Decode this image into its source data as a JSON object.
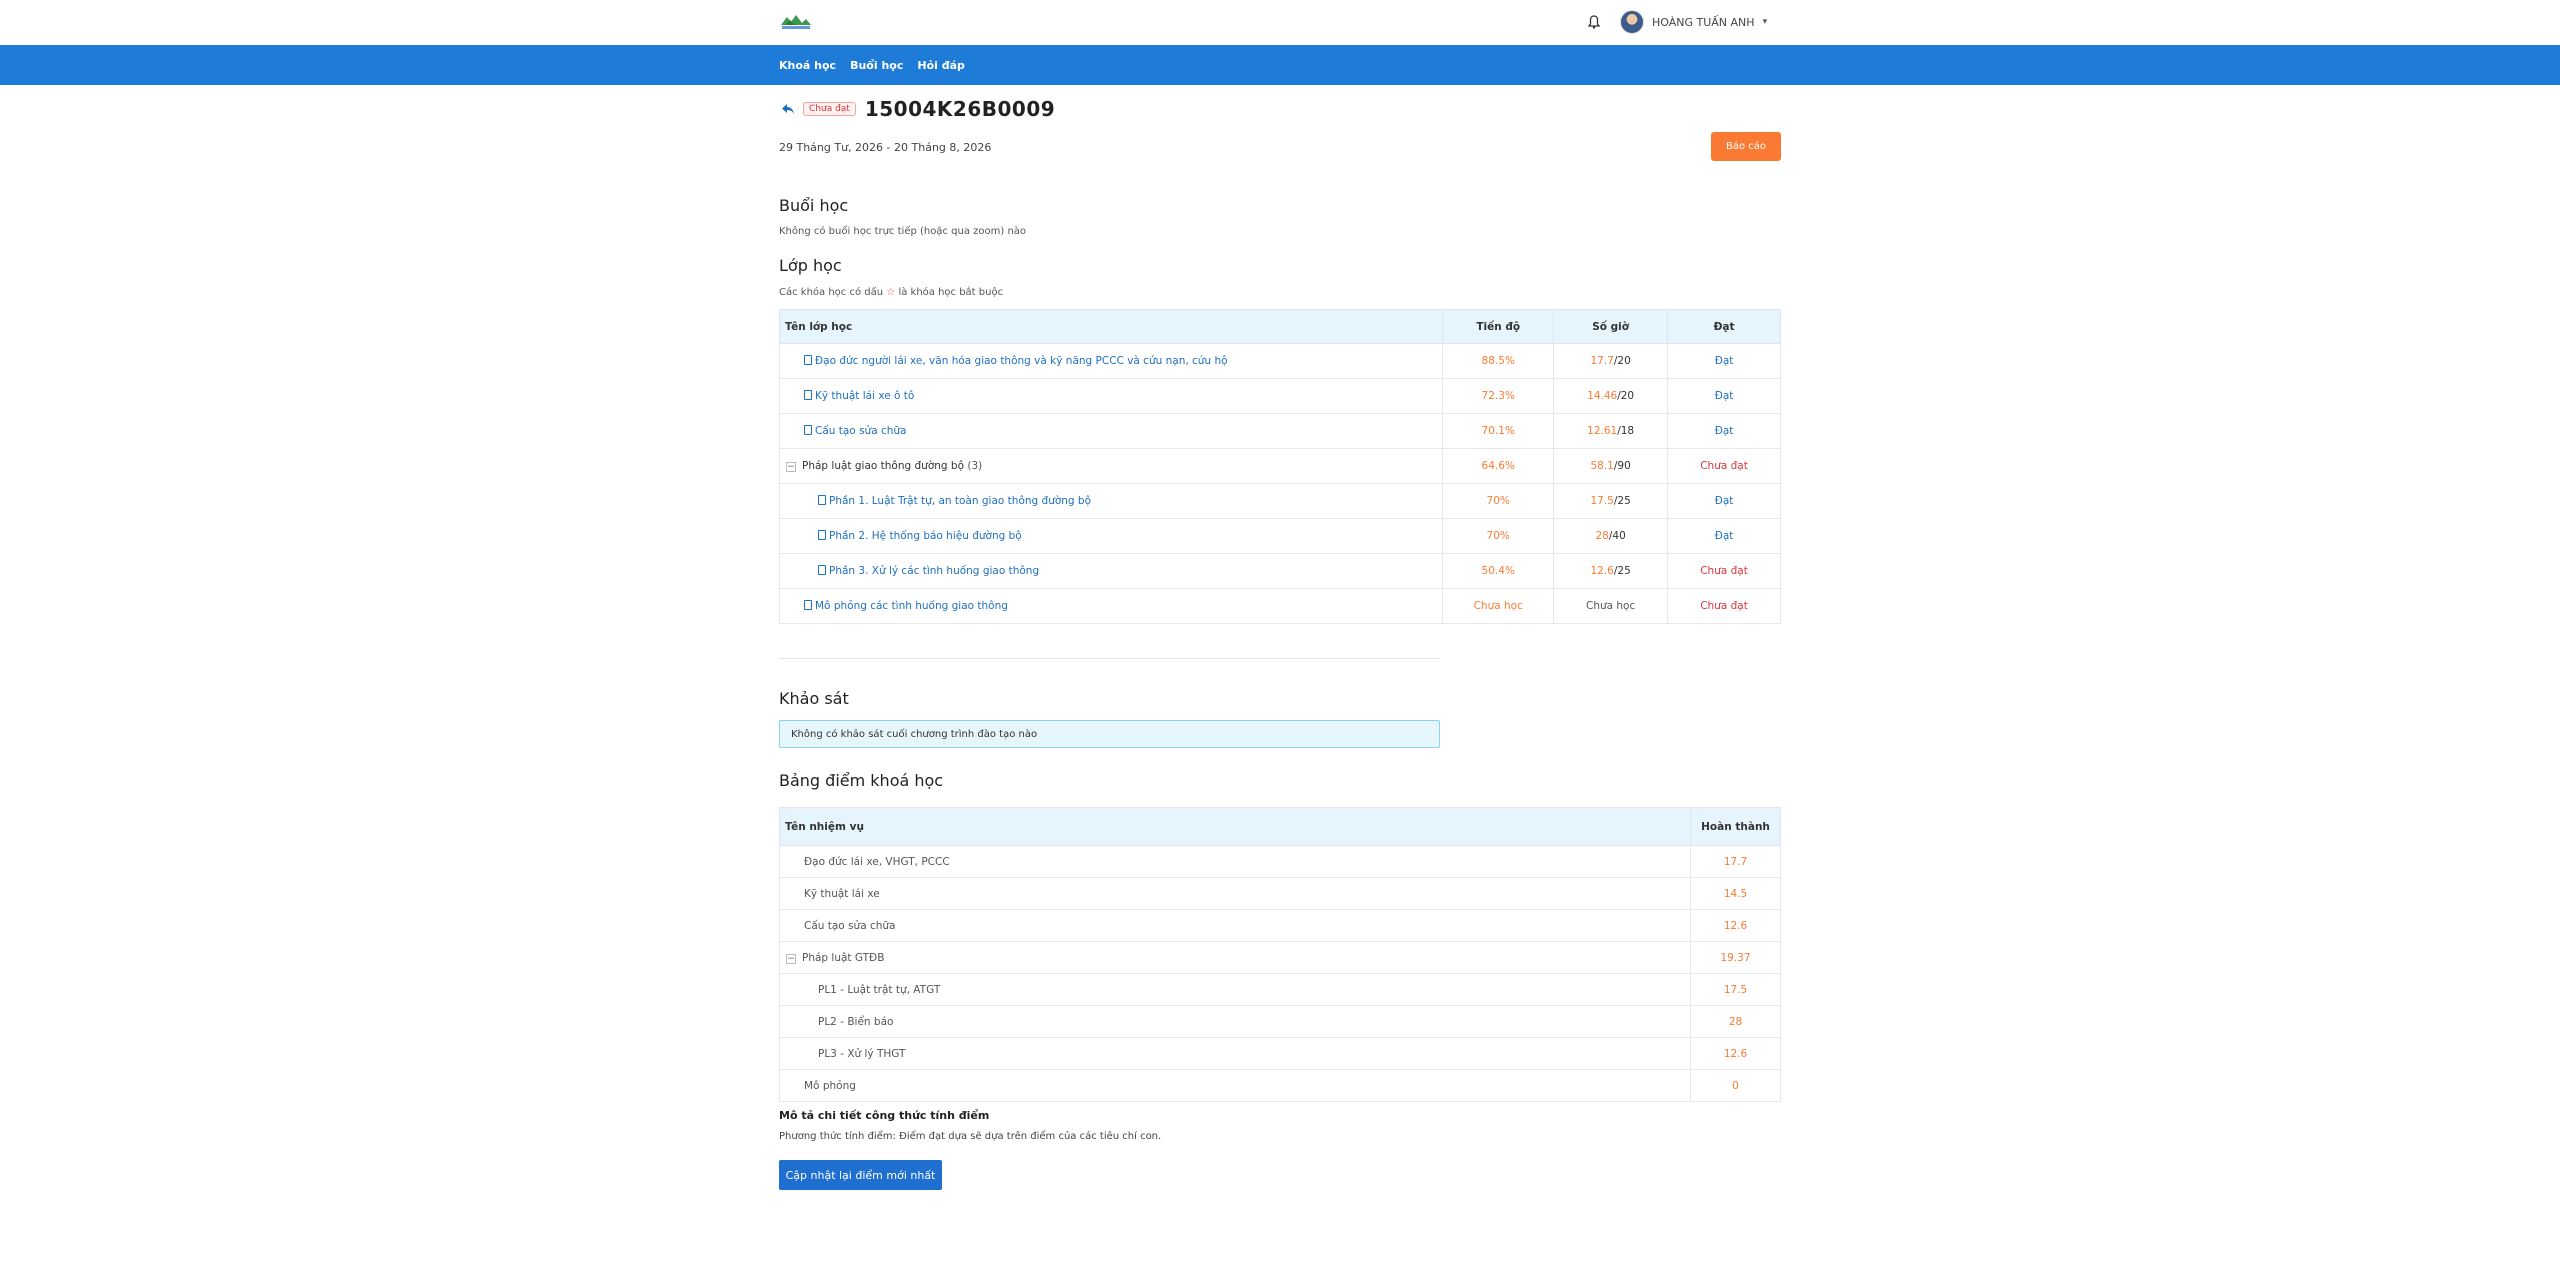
{
  "header": {
    "user_name": "HOÀNG TUẤN ANH"
  },
  "nav": {
    "items": [
      "Khoá học",
      "Buổi học",
      "Hỏi đáp"
    ]
  },
  "course": {
    "status_badge": "Chưa đạt",
    "code": "15004K26B0009",
    "date_range": "29 Tháng Tư, 2026 - 20 Tháng 8, 2026",
    "report_button": "Báo cáo"
  },
  "sessions": {
    "title": "Buổi học",
    "empty_text": "Không có buổi học trực tiếp (hoặc qua zoom) nào"
  },
  "classes": {
    "title": "Lớp học",
    "note_prefix": "Các khóa học có dấu",
    "note_star": "☆",
    "note_suffix": "là khóa học bắt buộc",
    "columns": {
      "name": "Tên lớp học",
      "progress": "Tiến độ",
      "hours": "Số giờ",
      "pass": "Đạt"
    },
    "rows": [
      {
        "name": "Đạo đức người lái xe, văn hóa giao thông và kỹ năng PCCC và cứu nạn, cứu hộ",
        "progress": "88.5%",
        "hours_done": "17.7",
        "hours_total": "/20",
        "pass": "Đạt"
      },
      {
        "name": "Kỹ thuật lái xe ô tô",
        "progress": "72.3%",
        "hours_done": "14.46",
        "hours_total": "/20",
        "pass": "Đạt"
      },
      {
        "name": "Cấu tạo sửa chữa",
        "progress": "70.1%",
        "hours_done": "12.61",
        "hours_total": "/18",
        "pass": "Đạt"
      },
      {
        "name": "Pháp luật giao thông đường bộ",
        "count": "(3)",
        "progress": "64.6%",
        "hours_done": "58.1",
        "hours_total": "/90",
        "pass": "Chưa đạt"
      },
      {
        "name": "Phần 1. Luật Trật tự, an toàn giao thông đường bộ",
        "progress": "70%",
        "hours_done": "17.5",
        "hours_total": "/25",
        "pass": "Đạt"
      },
      {
        "name": "Phần 2. Hệ thống báo hiệu đường bộ",
        "progress": "70%",
        "hours_done": "28",
        "hours_total": "/40",
        "pass": "Đạt"
      },
      {
        "name": "Phần 3. Xử lý các tình huống giao thông",
        "progress": "50.4%",
        "hours_done": "12.6",
        "hours_total": "/25",
        "pass": "Chưa đạt"
      },
      {
        "name": "Mô phỏng các tình huống giao thông",
        "progress": "Chưa học",
        "hours": "Chưa học",
        "pass": "Chưa đạt"
      }
    ]
  },
  "survey": {
    "title": "Khảo sát",
    "empty_text": "Không có khảo sát cuối chương trình đào tạo nào"
  },
  "scores": {
    "title": "Bảng điểm khoá học",
    "columns": {
      "task": "Tên nhiệm vụ",
      "done": "Hoàn thành"
    },
    "rows": [
      {
        "name": "Đạo đức lái xe, VHGT, PCCC",
        "value": "17.7"
      },
      {
        "name": "Kỹ thuật lái xe",
        "value": "14.5"
      },
      {
        "name": "Cấu tạo sửa chữa",
        "value": "12.6"
      },
      {
        "name": "Pháp luật GTĐB",
        "value": "19.37"
      },
      {
        "name": "PL1 - Luật trật tự, ATGT",
        "value": "17.5"
      },
      {
        "name": "PL2 - Biển báo",
        "value": "28"
      },
      {
        "name": "PL3 - Xử lý THGT",
        "value": "12.6"
      },
      {
        "name": "Mô phỏng",
        "value": "0"
      }
    ],
    "formula_title": "Mô tả chi tiết công thức tính điểm",
    "formula_text": "Phương thức tính điểm: Điểm đạt dựa sẽ dựa trên điểm của các tiêu chí con.",
    "update_button": "Cập nhật lại điểm mới nhất"
  },
  "colors": {
    "nav_blue": "#1f7bd8",
    "accent_orange": "#fb7a33",
    "fail_red": "#d9363e",
    "link_blue": "#1f6fbf"
  }
}
